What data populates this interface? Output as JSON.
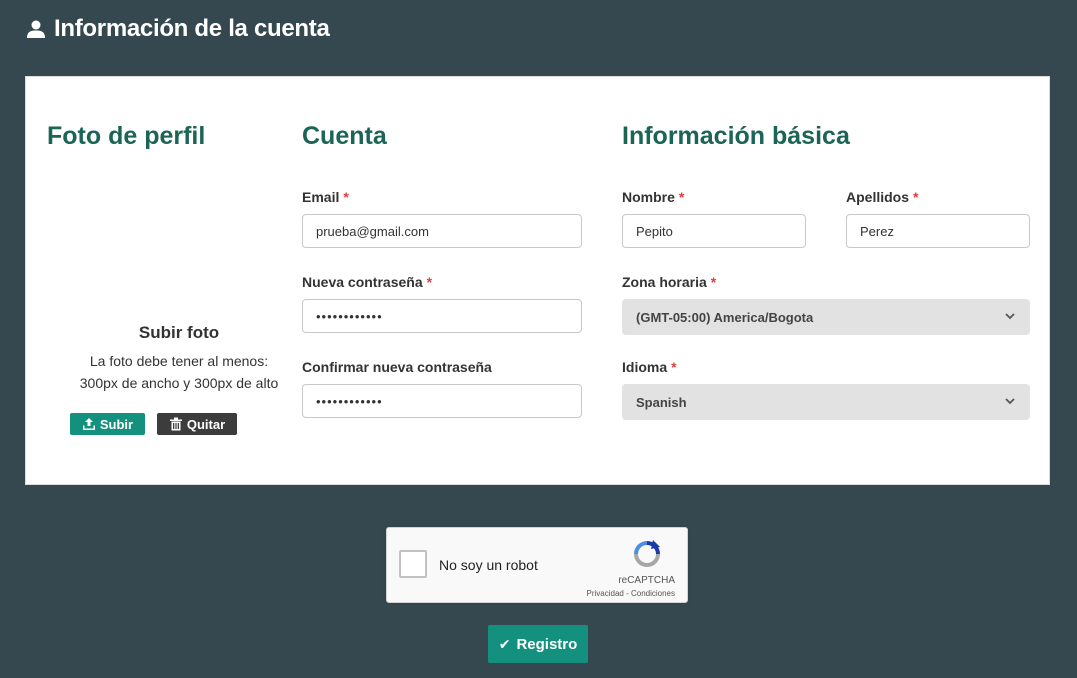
{
  "header": {
    "title": "Información de la cuenta",
    "icon": "user-icon"
  },
  "profile_photo": {
    "title": "Foto de perfil",
    "upload_title": "Subir foto",
    "upload_desc_line1": "La foto debe tener al menos:",
    "upload_desc_line2": "300px de ancho y 300px de alto",
    "upload_button": "Subir",
    "remove_button": "Quitar",
    "upload_button_color": "#14907f",
    "remove_button_color": "#3c3c3c"
  },
  "account": {
    "title": "Cuenta",
    "email_label": "Email",
    "email_value": "prueba@gmail.com",
    "new_password_label": "Nueva contraseña",
    "new_password_value": "••••••••••••",
    "confirm_password_label": "Confirmar nueva contraseña",
    "confirm_password_value": "••••••••••••"
  },
  "basic_info": {
    "title": "Información básica",
    "first_name_label": "Nombre",
    "first_name_value": "Pepito",
    "last_name_label": "Apellidos",
    "last_name_value": "Perez",
    "timezone_label": "Zona horaria",
    "timezone_value": "(GMT-05:00) America/Bogota",
    "language_label": "Idioma",
    "language_value": "Spanish"
  },
  "required_marker": "*",
  "captcha": {
    "label": "No soy un robot",
    "brand": "reCAPTCHA",
    "links": "Privacidad - Condiciones"
  },
  "submit": {
    "check": "✔",
    "label": "Registro"
  },
  "colors": {
    "background": "#35474f",
    "section_title": "#1b6456",
    "accent": "#14907f",
    "required": "#e23d3d"
  }
}
